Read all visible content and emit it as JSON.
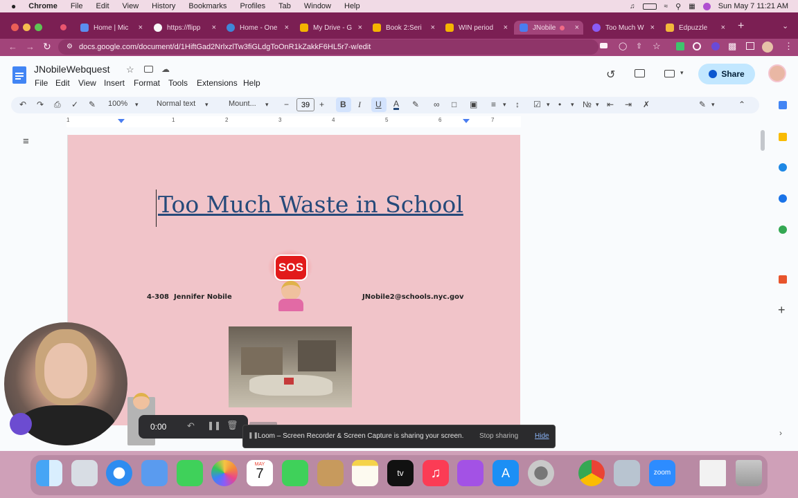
{
  "mac_menu": {
    "app": "Chrome",
    "items": [
      "File",
      "Edit",
      "View",
      "History",
      "Bookmarks",
      "Profiles",
      "Tab",
      "Window",
      "Help"
    ],
    "datetime": "Sun May 7  11:21 AM"
  },
  "tabs": [
    {
      "label": "Home | Mic",
      "color": "#5b8ef0"
    },
    {
      "label": "https://flipp",
      "color": "#ffffff"
    },
    {
      "label": "Home - One",
      "color": "#3f87d8"
    },
    {
      "label": "My Drive - G",
      "color": "#f4b400"
    },
    {
      "label": "Book 2:Seri",
      "color": "#f4b400"
    },
    {
      "label": "WIN period",
      "color": "#f4b400"
    },
    {
      "label": "JNobile",
      "color": "#4a7df0"
    },
    {
      "label": "Too Much W",
      "color": "#8a5cf6"
    },
    {
      "label": "Edpuzzle",
      "color": "#f2b83a"
    }
  ],
  "url": "docs.google.com/document/d/1HiftGad2NrlxzlTw3fiGLdgToOnR1kZakkF6HL5r7-w/edit",
  "docs": {
    "title": "JNobileWebquest",
    "menu": [
      "File",
      "Edit",
      "View",
      "Insert",
      "Format",
      "Tools",
      "Extensions",
      "Help"
    ],
    "share_label": "Share",
    "zoom": "100%",
    "style": "Normal text",
    "font": "Mount...",
    "font_size": "39",
    "ruler_numbers": [
      "1",
      "1",
      "2",
      "3",
      "4",
      "5",
      "6",
      "7"
    ]
  },
  "content": {
    "heading": "Too Much Waste in School",
    "sos": "SOS",
    "class_code": "4-308",
    "name": "Jennifer Nobile",
    "email": "JNobile2@schools.nyc.gov"
  },
  "recorder": {
    "time": "0:00"
  },
  "loom_banner": {
    "message": "Loom – Screen Recorder & Screen Capture is sharing your screen.",
    "stop": "Stop sharing",
    "hide": "Hide"
  },
  "dock": {
    "calendar_month": "MAY",
    "calendar_day": "7",
    "zoom_label": "zoom"
  },
  "colors": {
    "tabstrip": "#7b1f53",
    "page": "#f1c4c9",
    "heading": "#264a7a",
    "share_bg": "#c2e7ff"
  }
}
